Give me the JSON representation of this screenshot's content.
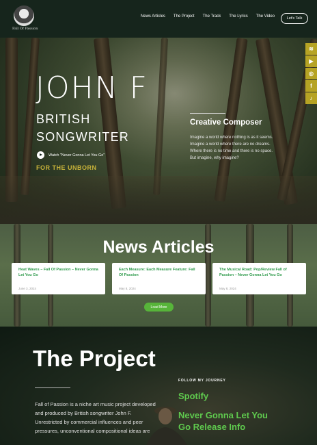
{
  "header": {
    "logo_text": "Fall Of Passion",
    "nav": [
      "News Articles",
      "The Project",
      "The Track",
      "The Lyrics",
      "The Video"
    ],
    "cta": "Let's Talk"
  },
  "hero": {
    "title": "JOHN F",
    "subtitle_line1": "BRITISH",
    "subtitle_line2": "SONGWRITER",
    "watch_label": "Watch \"Never Gonna Let You Go\"",
    "tagline": "FOR THE UNBORN",
    "composer_heading": "Creative Composer",
    "poem": [
      "Imagine a world where nothing is as it seems.",
      "Imagine a world where there are no dreams.",
      "Where there is no time and there is no space.",
      "But imagine, why imagine?"
    ]
  },
  "social": [
    {
      "icon": "spotify-icon",
      "glyph": "≋"
    },
    {
      "icon": "youtube-icon",
      "glyph": "▶"
    },
    {
      "icon": "instagram-icon",
      "glyph": "◎"
    },
    {
      "icon": "facebook-icon",
      "glyph": "f"
    },
    {
      "icon": "tiktok-icon",
      "glyph": "♪"
    }
  ],
  "news": {
    "title": "News Articles",
    "cards": [
      {
        "title": "Heat Waves – Fall Of Passion – Never Gonna Let You Go",
        "date": "June 3, 2024"
      },
      {
        "title": "Each Measure: Each Measure Feature: Fall Of Passion",
        "date": "May 8, 2024"
      },
      {
        "title": "The Musical Road: Pop/Review Fall of Passion – Never Gonna Let You Go",
        "date": "May 8, 2024"
      }
    ],
    "load_more": "Load More"
  },
  "project": {
    "title": "The Project",
    "text": "Fall of Passion is a niche art music project developed and produced by British songwriter John F. Unrestricted by commercial influences and peer pressures, unconventional compositional ideas are",
    "follow_label": "FOLLOW MY JOURNEY",
    "spotify": "Spotify",
    "release": "Never Gonna Let You Go Release Info"
  },
  "colors": {
    "header_bg": "#16251c",
    "accent_gold": "#b6a324",
    "accent_green": "#5fca4e",
    "button_green": "#57b43a"
  }
}
